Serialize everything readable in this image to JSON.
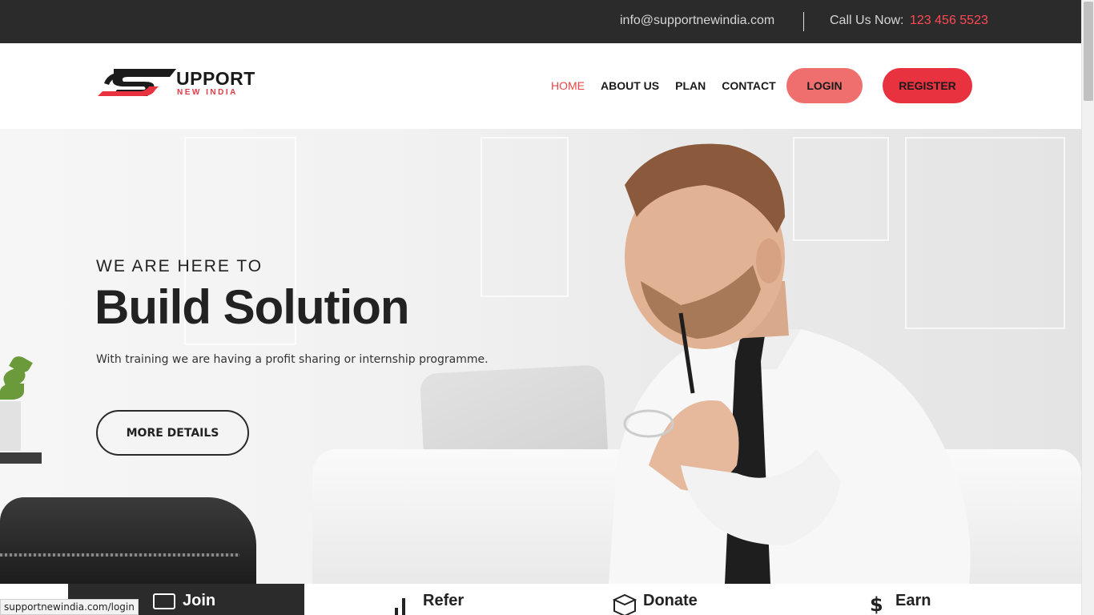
{
  "topbar": {
    "email": "info@supportnewindia.com",
    "call_label": "Call Us Now:",
    "phone": "123 456 5523"
  },
  "logo": {
    "title": "UPPORT",
    "subtitle": "NEW INDIA"
  },
  "nav": {
    "items": [
      {
        "label": "HOME",
        "active": true
      },
      {
        "label": "ABOUT US",
        "active": false
      },
      {
        "label": "PLAN",
        "active": false
      },
      {
        "label": "CONTACT",
        "active": false
      }
    ],
    "login_label": "LOGIN",
    "register_label": "REGISTER"
  },
  "hero": {
    "eyebrow": "WE ARE HERE TO",
    "title": "Build Solution",
    "subtitle": "With training we are having a profit sharing or internship programme.",
    "button_label": "MORE DETAILS"
  },
  "features": [
    {
      "label": "Join",
      "icon": "monitor-icon"
    },
    {
      "label": "Refer",
      "icon": "bar-chart-icon"
    },
    {
      "label": "Donate",
      "icon": "box-icon"
    },
    {
      "label": "Earn",
      "icon": "dollar-icon"
    }
  ],
  "status_bar": {
    "url": "supportnewindia.com/login"
  },
  "colors": {
    "accent": "#e8323f",
    "accent_light": "#ef6f6f",
    "topbar_bg": "#2b2b2b",
    "phone": "#ff4a55"
  }
}
